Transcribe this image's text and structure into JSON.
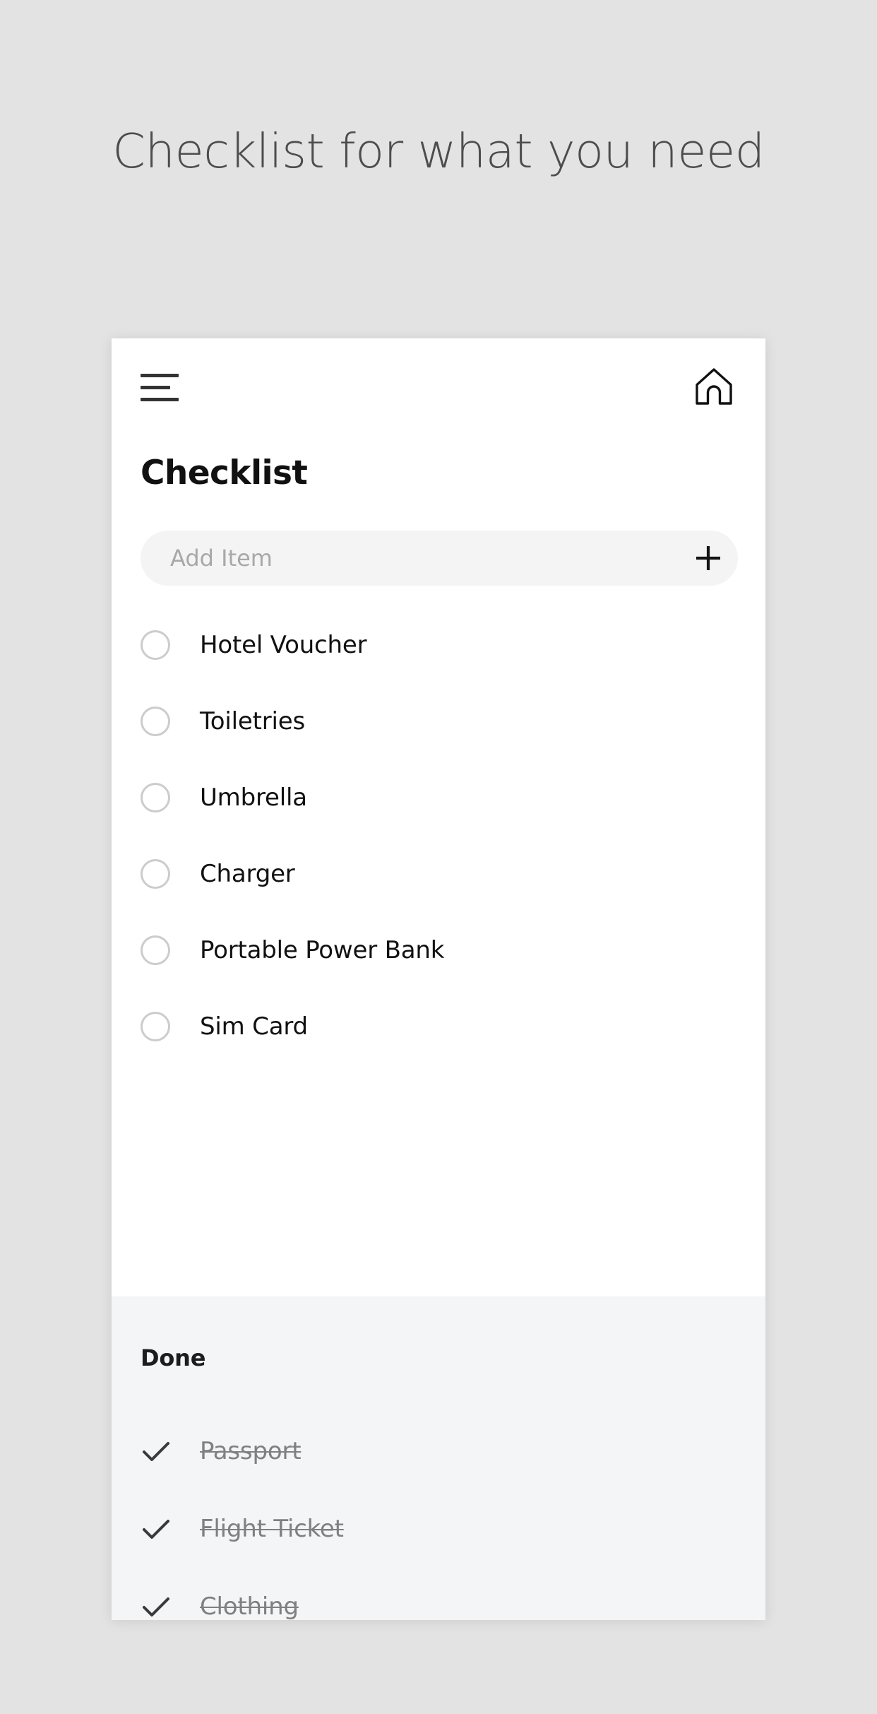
{
  "page": {
    "title": "Checklist for what you need",
    "background_color": "#e3e3e3"
  },
  "card": {
    "background_color": "#ffffff",
    "app_bar": {
      "menu_icon": "hamburger-menu-icon",
      "home_icon": "home-icon"
    },
    "screen_title": "Checklist",
    "add_item": {
      "placeholder": "Add Item",
      "value": "",
      "add_icon": "plus-icon",
      "field_background": "#f4f4f4"
    },
    "todo": {
      "items": [
        {
          "label": "Hotel Voucher",
          "checked": false
        },
        {
          "label": "Toiletries",
          "checked": false
        },
        {
          "label": "Umbrella",
          "checked": false
        },
        {
          "label": "Charger",
          "checked": false
        },
        {
          "label": "Portable Power Bank",
          "checked": false
        },
        {
          "label": "Sim Card",
          "checked": false
        }
      ]
    },
    "done": {
      "heading": "Done",
      "background_color": "#f4f5f7",
      "items": [
        {
          "label": "Passport",
          "checked": true
        },
        {
          "label": "Flight Ticket",
          "checked": true
        },
        {
          "label": "Clothing",
          "checked": true
        }
      ]
    }
  }
}
